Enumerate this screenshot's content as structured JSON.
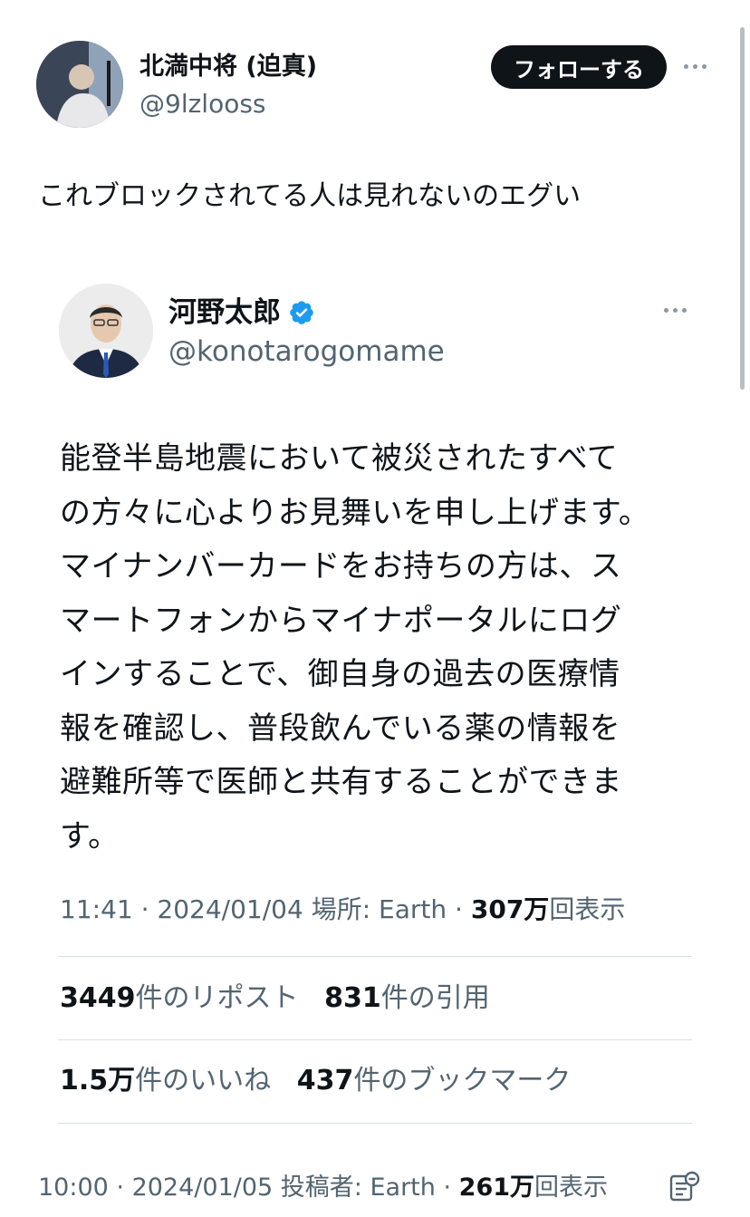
{
  "outer_tweet": {
    "display_name": "北満中将 (迫真)",
    "handle": "@9lzlooss",
    "follow_label": "フォローする",
    "text": "これブロックされてる人は見れないのエグい",
    "time": "10:00",
    "date": "2024/01/05",
    "location": "投稿者: Earth",
    "views_num": "261万",
    "views_label": "回表示"
  },
  "quoted_tweet": {
    "display_name": "河野太郎",
    "handle": "@konotarogomame",
    "body_lines": [
      "能登半島地震において被災されたすべて",
      "の方々に心よりお見舞いを申し上げます。",
      "マイナンバーカードをお持ちの方は、ス",
      "マートフォンからマイナポータルにログ",
      "インすることで、御自身の過去の医療情",
      "報を確認し、普段飲んでいる薬の情報を",
      "避難所等で医師と共有することができま",
      "す。"
    ],
    "time": "11:41",
    "date": "2024/01/04",
    "location": "場所: Earth",
    "views_num": "307万",
    "views_label": "回表示",
    "reposts_num": "3449",
    "reposts_label": "件のリポスト",
    "quotes_num": "831",
    "quotes_label": "件の引用",
    "likes_num": "1.5万",
    "likes_label": "件のいいね",
    "bookmarks_num": "437",
    "bookmarks_label": "件のブックマーク"
  },
  "icons": {
    "more": "more-horizontal-icon",
    "verified": "verified-badge-icon",
    "analytics": "analytics-icon"
  },
  "colors": {
    "verified_blue": "#1d9bf0",
    "secondary_text": "#536471",
    "primary_text": "#0f1419"
  }
}
